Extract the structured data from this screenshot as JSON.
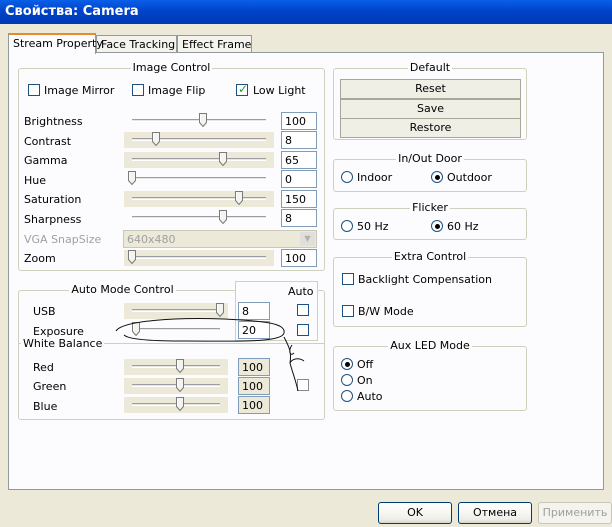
{
  "window": {
    "title": "Свойства: Camera"
  },
  "tabs": [
    {
      "label": "Stream Property",
      "active": true
    },
    {
      "label": "Face Tracking",
      "active": false
    },
    {
      "label": "Effect  Frame",
      "active": false
    }
  ],
  "image_control": {
    "title": "Image Control",
    "checkboxes": [
      {
        "label": "Image Mirror",
        "checked": false
      },
      {
        "label": "Image Flip",
        "checked": false
      },
      {
        "label": "Low Light",
        "checked": true
      }
    ],
    "rows": [
      {
        "label": "Brightness",
        "value": "100",
        "level": 0.53,
        "enabled": true
      },
      {
        "label": "Contrast",
        "value": "8",
        "level": 0.18,
        "enabled": true
      },
      {
        "label": "Gamma",
        "value": "65",
        "level": 0.68,
        "enabled": true
      },
      {
        "label": "Hue",
        "value": "0",
        "level": 0.0,
        "enabled": true
      },
      {
        "label": "Saturation",
        "value": "150",
        "level": 0.8,
        "enabled": true
      },
      {
        "label": "Sharpness",
        "value": "8",
        "level": 0.68,
        "enabled": true
      }
    ],
    "vga_snapsize": {
      "label": "VGA SnapSize",
      "value": "640x480"
    },
    "zoom": {
      "label": "Zoom",
      "value": "100",
      "level": 0.0
    }
  },
  "auto_mode": {
    "title": "Auto Mode Control",
    "auto_label": "Auto",
    "rows": [
      {
        "label": "USB",
        "value": "8",
        "level": 1.0,
        "auto": false
      },
      {
        "label": "Exposure",
        "value": "20",
        "level": 0.05,
        "auto": false
      }
    ]
  },
  "white_balance": {
    "title": "White Balance",
    "auto": false,
    "rows": [
      {
        "label": "Red",
        "value": "100",
        "level": 0.55
      },
      {
        "label": "Green",
        "value": "100",
        "level": 0.55
      },
      {
        "label": "Blue",
        "value": "100",
        "level": 0.55
      }
    ]
  },
  "default_group": {
    "title": "Default",
    "buttons": [
      "Reset",
      "Save",
      "Restore"
    ]
  },
  "inout_door": {
    "title": "In/Out Door",
    "options": [
      {
        "label": "Indoor",
        "selected": false
      },
      {
        "label": "Outdoor",
        "selected": true
      }
    ]
  },
  "flicker": {
    "title": "Flicker",
    "options": [
      {
        "label": "50 Hz",
        "selected": false
      },
      {
        "label": "60 Hz",
        "selected": true
      }
    ]
  },
  "extra_control": {
    "title": "Extra Control",
    "checkboxes": [
      {
        "label": "Backlight Compensation",
        "checked": false
      },
      {
        "label": "B/W Mode",
        "checked": false
      }
    ]
  },
  "aux_led": {
    "title": "Aux LED Mode",
    "options": [
      {
        "label": "Off",
        "selected": true
      },
      {
        "label": "On",
        "selected": false
      },
      {
        "label": "Auto",
        "selected": false
      }
    ]
  },
  "footer": {
    "ok": "OK",
    "cancel": "Отмена",
    "apply": "Применить"
  }
}
